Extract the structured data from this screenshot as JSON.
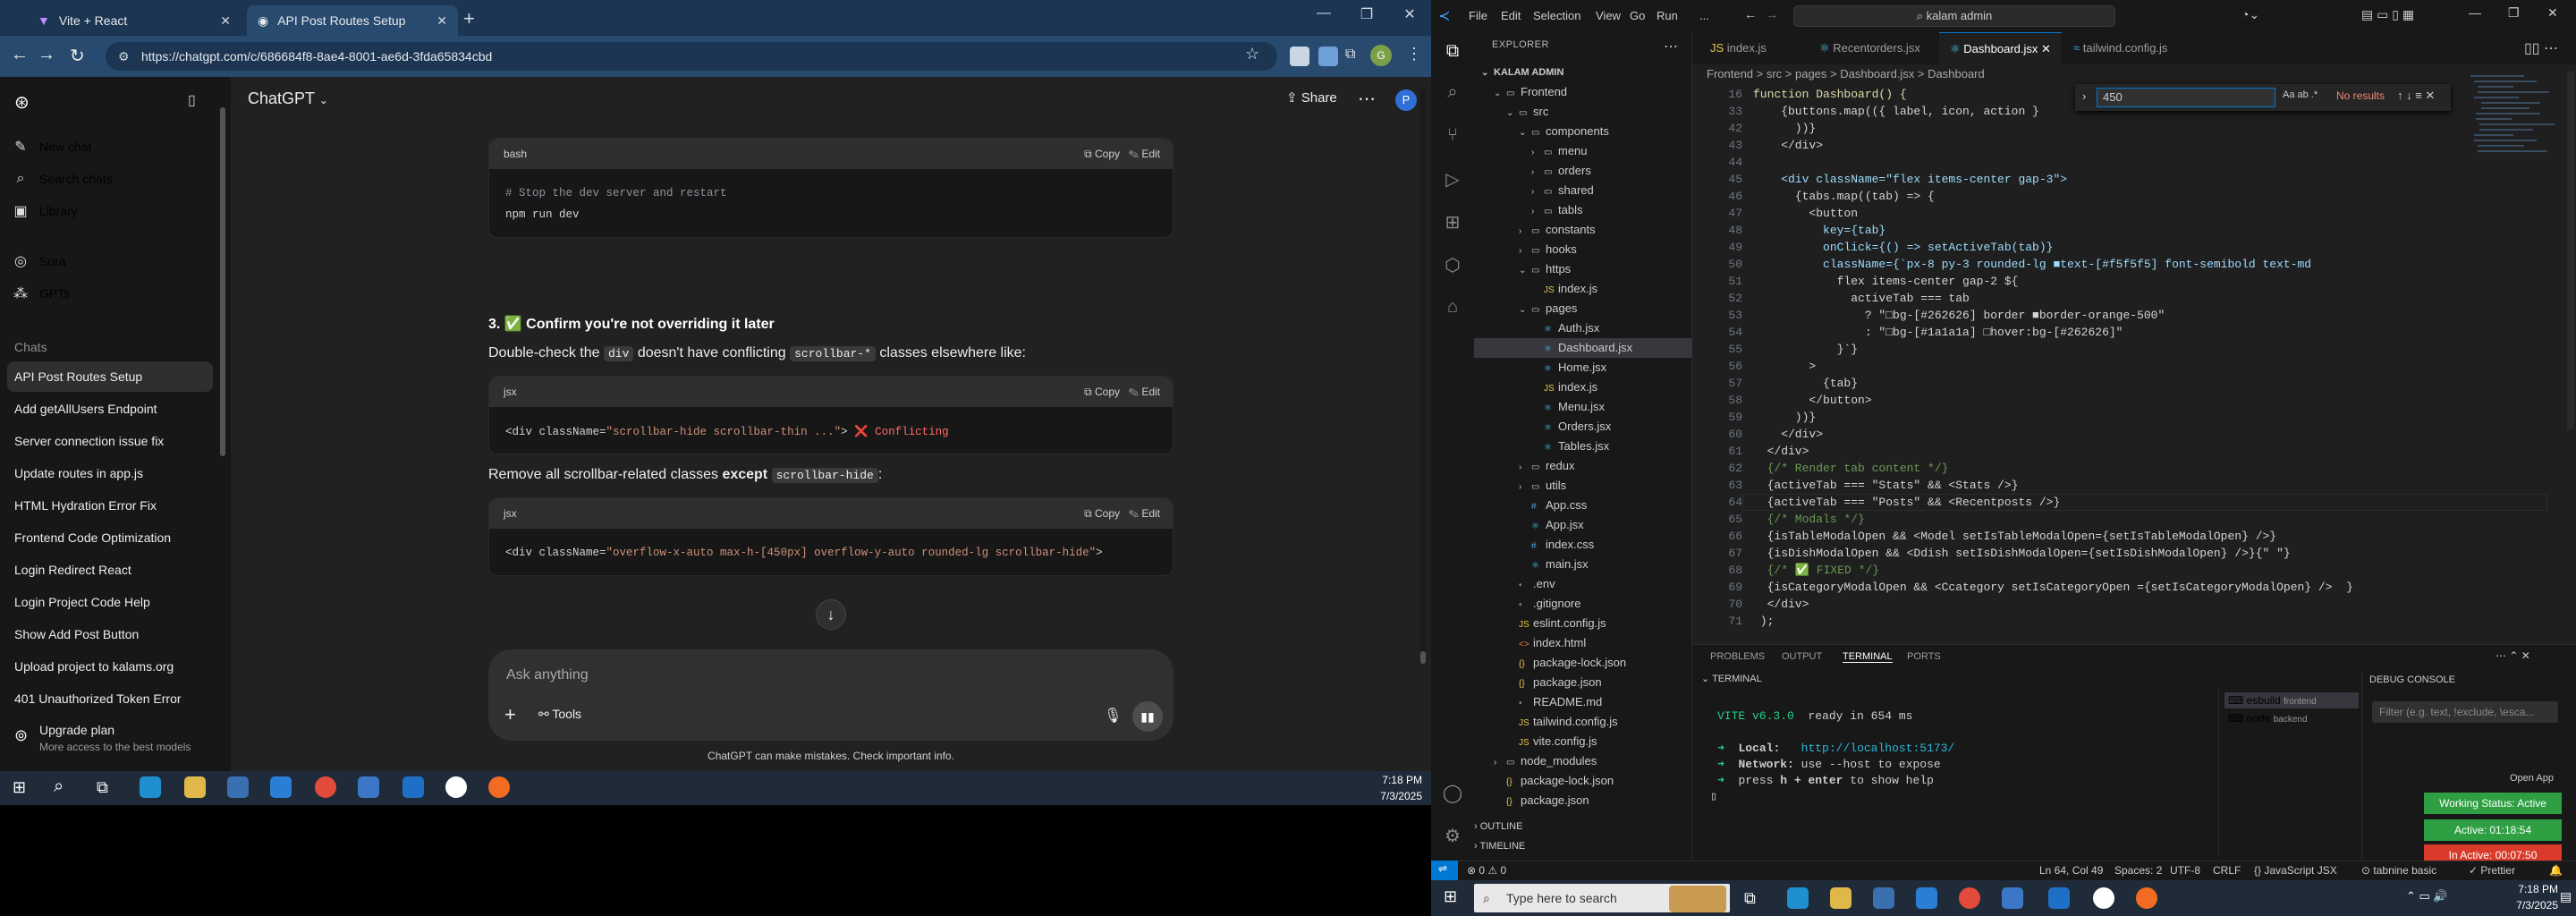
{
  "browser": {
    "tabs": [
      {
        "title": "Vite + React"
      },
      {
        "title": "API Post Routes Setup"
      }
    ],
    "url": "https://chatgpt.com/c/686684f8-8ae4-8001-ae6d-3fda65834cbd"
  },
  "chatgpt": {
    "sidebar": {
      "items": [
        {
          "label": "New chat",
          "icon": "new-chat-icon"
        },
        {
          "label": "Search chats",
          "icon": "search-icon"
        },
        {
          "label": "Library",
          "icon": "library-icon"
        },
        {
          "label": "Sora",
          "icon": "sora-icon"
        },
        {
          "label": "GPTs",
          "icon": "gpts-icon"
        }
      ],
      "chats_heading": "Chats",
      "chats": [
        "API Post Routes Setup",
        "Add getAllUsers Endpoint",
        "Server connection issue fix",
        "Update routes in app.js",
        "HTML Hydration Error Fix",
        "Frontend Code Optimization",
        "Login Redirect React",
        "Login Project Code Help",
        "Show Add Post Button",
        "Upload project to kalams.org",
        "401 Unauthorized Token Error"
      ],
      "upgrade": {
        "title": "Upgrade plan",
        "subtitle": "More access to the best models"
      }
    },
    "header": {
      "model": "ChatGPT",
      "share": "Share"
    },
    "conversation": {
      "code1": {
        "lang": "bash",
        "lines": [
          "# Stop the dev server and restart",
          "npm run dev"
        ]
      },
      "copy_label": "Copy",
      "edit_label": "Edit",
      "heading": "3. ✅ Confirm you're not overriding it later",
      "para1_a": "Double-check the ",
      "para1_code1": "div",
      "para1_b": " doesn't have conflicting ",
      "para1_code2": "scrollbar-*",
      "para1_c": " classes elsewhere like:",
      "code2": {
        "lang": "jsx",
        "pre": "<div className=",
        "str": "\"scrollbar-hide scrollbar-thin ...\"",
        "post": ">",
        "mark": "❌ Conflicting"
      },
      "para2_a": "Remove all scrollbar-related classes ",
      "para2_b": "except",
      "para2_code": "scrollbar-hide",
      "para2_c": ":",
      "code3": {
        "lang": "jsx",
        "pre": "<div className=",
        "str": "\"overflow-x-auto max-h-[450px] overflow-y-auto rounded-lg scrollbar-hide\"",
        "post": ">"
      }
    },
    "composer": {
      "placeholder": "Ask anything",
      "tools": "Tools"
    },
    "disclaimer": "ChatGPT can make mistakes. Check important info."
  },
  "taskbar_left": {
    "time": "7:18 PM",
    "date": "7/3/2025"
  },
  "vscode": {
    "menu": [
      "File",
      "Edit",
      "Selection",
      "View",
      "Go",
      "Run",
      "..."
    ],
    "command_center": "kalam admin",
    "explorer_title": "EXPLORER",
    "workspace": "KALAM ADMIN",
    "tree": [
      {
        "name": "Frontend",
        "kind": "folder-open",
        "depth": 1
      },
      {
        "name": "src",
        "kind": "folder-open",
        "depth": 2
      },
      {
        "name": "components",
        "kind": "folder-open",
        "depth": 3
      },
      {
        "name": "menu",
        "kind": "folder",
        "depth": 4
      },
      {
        "name": "orders",
        "kind": "folder",
        "depth": 4
      },
      {
        "name": "shared",
        "kind": "folder",
        "depth": 4
      },
      {
        "name": "tabls",
        "kind": "folder",
        "depth": 4
      },
      {
        "name": "constants",
        "kind": "folder",
        "depth": 3
      },
      {
        "name": "hooks",
        "kind": "folder",
        "depth": 3
      },
      {
        "name": "https",
        "kind": "folder-open",
        "depth": 3
      },
      {
        "name": "index.js",
        "kind": "js",
        "depth": 4
      },
      {
        "name": "pages",
        "kind": "folder-open",
        "depth": 3
      },
      {
        "name": "Auth.jsx",
        "kind": "jsx",
        "depth": 4
      },
      {
        "name": "Dashboard.jsx",
        "kind": "jsx",
        "depth": 4,
        "selected": true
      },
      {
        "name": "Home.jsx",
        "kind": "jsx",
        "depth": 4
      },
      {
        "name": "index.js",
        "kind": "js",
        "depth": 4
      },
      {
        "name": "Menu.jsx",
        "kind": "jsx",
        "depth": 4
      },
      {
        "name": "Orders.jsx",
        "kind": "jsx",
        "depth": 4
      },
      {
        "name": "Tables.jsx",
        "kind": "jsx",
        "depth": 4
      },
      {
        "name": "redux",
        "kind": "folder",
        "depth": 3
      },
      {
        "name": "utils",
        "kind": "folder",
        "depth": 3
      },
      {
        "name": "App.css",
        "kind": "css",
        "depth": 3
      },
      {
        "name": "App.jsx",
        "kind": "jsx",
        "depth": 3
      },
      {
        "name": "index.css",
        "kind": "css",
        "depth": 3
      },
      {
        "name": "main.jsx",
        "kind": "jsx",
        "depth": 3
      },
      {
        "name": ".env",
        "kind": "dot",
        "depth": 2
      },
      {
        "name": ".gitignore",
        "kind": "dot",
        "depth": 2
      },
      {
        "name": "eslint.config.js",
        "kind": "js",
        "depth": 2
      },
      {
        "name": "index.html",
        "kind": "html",
        "depth": 2
      },
      {
        "name": "package-lock.json",
        "kind": "json",
        "depth": 2
      },
      {
        "name": "package.json",
        "kind": "json",
        "depth": 2
      },
      {
        "name": "README.md",
        "kind": "dot",
        "depth": 2
      },
      {
        "name": "tailwind.config.js",
        "kind": "js",
        "depth": 2
      },
      {
        "name": "vite.config.js",
        "kind": "js",
        "depth": 2
      },
      {
        "name": "node_modules",
        "kind": "folder",
        "depth": 1
      },
      {
        "name": "package-lock.json",
        "kind": "json",
        "depth": 1
      },
      {
        "name": "package.json",
        "kind": "json",
        "depth": 1
      }
    ],
    "outline": "OUTLINE",
    "timeline": "TIMELINE",
    "editor_tabs": [
      "index.js",
      "Recentorders.jsx",
      "Dashboard.jsx",
      "tailwind.config.js"
    ],
    "breadcrumbs": "Frontend > src > pages > Dashboard.jsx > Dashboard",
    "find": {
      "value": "450",
      "result": "No results"
    },
    "code_lines": [
      {
        "n": "16",
        "t": "function Dashboard() {"
      },
      {
        "n": "33",
        "t": "    {buttons.map(({ label, icon, action }"
      },
      {
        "n": "42",
        "t": "      ))}"
      },
      {
        "n": "43",
        "t": "    </div>"
      },
      {
        "n": "44",
        "t": ""
      },
      {
        "n": "45",
        "t": "    <div className=\"flex items-center gap-3\">"
      },
      {
        "n": "46",
        "t": "      {tabs.map((tab) => {"
      },
      {
        "n": "47",
        "t": "        <button"
      },
      {
        "n": "48",
        "t": "          key={tab}"
      },
      {
        "n": "49",
        "t": "          onClick={() => setActiveTab(tab)}"
      },
      {
        "n": "50",
        "t": "          className={`px-8 py-3 rounded-lg ■text-[#f5f5f5] font-semibold text-md"
      },
      {
        "n": "51",
        "t": "            flex items-center gap-2 ${"
      },
      {
        "n": "52",
        "t": "              activeTab === tab"
      },
      {
        "n": "53",
        "t": "                ? \"□bg-[#262626] border ■border-orange-500\""
      },
      {
        "n": "54",
        "t": "                : \"□bg-[#1a1a1a] □hover:bg-[#262626]\""
      },
      {
        "n": "55",
        "t": "            }`}"
      },
      {
        "n": "56",
        "t": "        >"
      },
      {
        "n": "57",
        "t": "          {tab}"
      },
      {
        "n": "58",
        "t": "        </button>"
      },
      {
        "n": "59",
        "t": "      ))}"
      },
      {
        "n": "60",
        "t": "    </div>"
      },
      {
        "n": "61",
        "t": "  </div>"
      },
      {
        "n": "62",
        "t": "  {/* Render tab content */}"
      },
      {
        "n": "63",
        "t": "  {activeTab === \"Stats\" && <Stats />}"
      },
      {
        "n": "64",
        "t": "  {activeTab === \"Posts\" && <Recentposts />}"
      },
      {
        "n": "65",
        "t": "  {/* Modals */}"
      },
      {
        "n": "66",
        "t": "  {isTableModalOpen && <Model setIsTableModalOpen={setIsTableModalOpen} />}"
      },
      {
        "n": "67",
        "t": "  {isDishModalOpen && <Ddish setIsDishModalOpen={setIsDishModalOpen} />}{\" \"}"
      },
      {
        "n": "68",
        "t": "  {/* ✅ FIXED */}"
      },
      {
        "n": "69",
        "t": "  {isCategoryModalOpen && <Ccategory setIsCategoryOpen ={setIsCategoryModalOpen} />  }"
      },
      {
        "n": "70",
        "t": "  </div>"
      },
      {
        "n": "71",
        "t": " );"
      }
    ],
    "panel_tabs": [
      "PROBLEMS",
      "OUTPUT",
      "TERMINAL",
      "PORTS"
    ],
    "terminal_title": "TERMINAL",
    "terminal": {
      "vite_line_a": "VITE v6.3.0",
      "vite_line_b": "  ready in 654 ms",
      "local_label": "Local:",
      "local_url": "http://localhost:5173/",
      "network_label": "Network:",
      "network_text": "use --host to expose",
      "help_a": "press ",
      "help_b": "h + enter",
      "help_c": " to show help"
    },
    "terminals": [
      {
        "name": "esbuild",
        "cwd": "frontend"
      },
      {
        "name": "node",
        "cwd": "backend"
      }
    ],
    "debug_title": "DEBUG CONSOLE",
    "debug_filter": "Filter (e.g. text, !exclude, \\esca...",
    "open_app": "Open App",
    "working_status": "Working Status: Active",
    "active_time": "Active: 01:18:54",
    "inactive_time": "In Active: 00:07:50",
    "status": {
      "errors": "0",
      "warnings": "0",
      "position": "Ln 64, Col 49",
      "spaces": "Spaces: 2",
      "encoding": "UTF-8",
      "eol": "CRLF",
      "language": "JavaScript JSX",
      "tabnine": "tabnine basic",
      "prettier": "Prettier"
    }
  },
  "taskbar_right": {
    "search_placeholder": "Type here to search",
    "time": "7:18 PM",
    "date": "7/3/2025"
  }
}
